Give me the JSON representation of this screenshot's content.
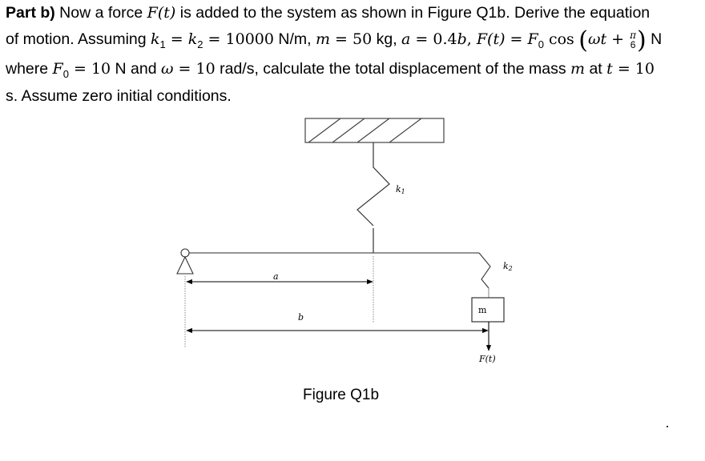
{
  "question": {
    "line1": {
      "part_label": "Part b)",
      "text_a": " Now a force ",
      "F_t": "F(t)",
      "text_b": " is added to the system as shown in Figure Q1b. Derive the equation"
    },
    "line2": {
      "text_a": "of motion. Assuming ",
      "k": "k",
      "k1_sub": "1",
      "eq1": " = ",
      "k2_sub": "2",
      "eq2": " = 10000",
      "unit_k": " N/m,  ",
      "m": "m",
      "eq3": " = ",
      "m_val": "50",
      "unit_m": " kg, ",
      "a": "a",
      "eq4": " = 0.4",
      "b": "b",
      "comma": ", ",
      "F": "F",
      "t_paren": "(t)",
      "eq5": " = ",
      "F0": "F",
      "F0_sub": "0",
      "cos": " cos",
      "open_paren": "(",
      "omega_t": "ωt",
      "plus": " + ",
      "frac_num": "π",
      "frac_den": "6",
      "close_paren": ")",
      "unit_N": " N"
    },
    "line3": {
      "text_a": "where ",
      "F0": "F",
      "F0_sub": "0",
      "eq1": " = 10",
      "text_b": " N and ",
      "omega": "ω",
      "eq2": " = 10",
      "text_c": " rad/s, calculate the total displacement of the mass ",
      "m": "m",
      "text_d": " at ",
      "t": "t",
      "eq3": " = 10"
    },
    "line4": {
      "text": "s. Assume zero initial conditions."
    }
  },
  "figure": {
    "labels": {
      "k1": "k",
      "k1_sub": "1",
      "k2": "k",
      "k2_sub": "2",
      "a": "a",
      "b": "b",
      "mass": "m",
      "force": "F(t)"
    },
    "caption": "Figure Q1b"
  }
}
